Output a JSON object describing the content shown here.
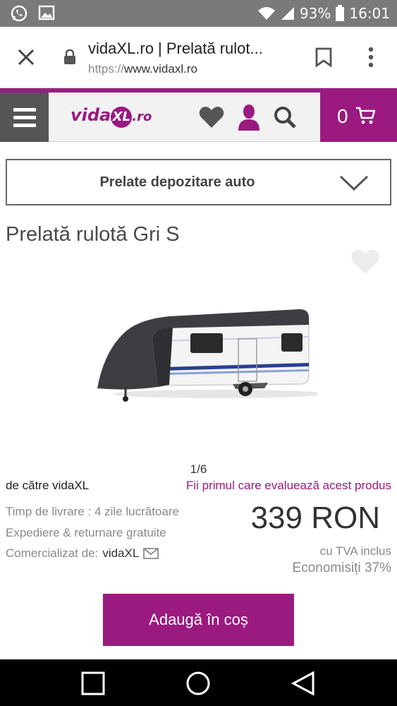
{
  "status_bar": {
    "battery": "93%",
    "time": "16:01",
    "icons": [
      "whatsapp-icon",
      "gallery-icon",
      "wifi-icon",
      "signal-icon",
      "battery-icon"
    ]
  },
  "browser": {
    "tab_title": "vidaXL.ro | Prelată rulot...",
    "url_scheme": "https://",
    "url_host": "www.vidaxl.ro"
  },
  "header": {
    "logo_vida": "vida",
    "logo_xl": "XL",
    "logo_ro": ".ro",
    "cart_count": "0"
  },
  "category": {
    "selected": "Prelate depozitare auto"
  },
  "product": {
    "title": "Prelată rulotă Gri S",
    "gallery_counter": "1/6",
    "seller_by": "de către vidaXL",
    "review_link": "Fii primul care evaluează acest produs",
    "delivery": "Timp de livrare : 4 zile lucrătoare",
    "shipping": "Expediere & returnare gratuite",
    "sold_by_label": "Comercializat de:",
    "sold_by_name": "vidaXL",
    "price": "339 RON",
    "vat": "cu TVA inclus",
    "savings": "Economisiți 37%",
    "add_to_cart": "Adaugă în coș"
  },
  "colors": {
    "brand": "#9a1a80",
    "status_bar": "#7a7a7a"
  }
}
